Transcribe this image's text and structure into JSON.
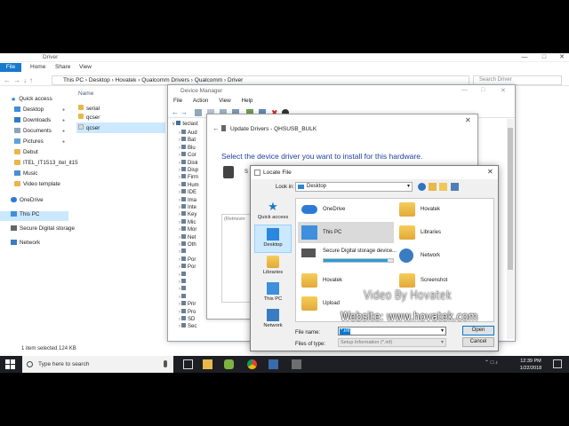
{
  "explorer": {
    "title": "Driver",
    "ribbon_file": "File",
    "ribbon_tabs": [
      "Home",
      "Share",
      "View"
    ],
    "breadcrumb": [
      "This PC",
      "Desktop",
      "Hovatek",
      "Qualcomm Drivers",
      "Qualcomm",
      "Driver"
    ],
    "search_placeholder": "Search Driver",
    "sidebar": [
      {
        "label": "Quick access",
        "icon": "star-icon"
      },
      {
        "label": "Desktop",
        "icon": "desktop-icon"
      },
      {
        "label": "Downloads",
        "icon": "download-icon"
      },
      {
        "label": "Documents",
        "icon": "documents-icon"
      },
      {
        "label": "Pictures",
        "icon": "pictures-icon"
      },
      {
        "label": "Debut",
        "icon": "folder-icon"
      },
      {
        "label": "ITEL_IT1513_itel_it15",
        "icon": "folder-icon"
      },
      {
        "label": "Music",
        "icon": "music-icon"
      },
      {
        "label": "Video template",
        "icon": "folder-icon"
      },
      {
        "label": "OneDrive",
        "icon": "cloud-icon"
      },
      {
        "label": "This PC",
        "icon": "pc-icon"
      },
      {
        "label": "Secure Digital storage",
        "icon": "drive-icon"
      },
      {
        "label": "Network",
        "icon": "network-icon"
      }
    ],
    "column_name": "Name",
    "files": [
      "serial",
      "qcser",
      "qcser"
    ],
    "status": "1 item selected  124 KB"
  },
  "device_manager": {
    "title": "Device Manager",
    "menu": [
      "File",
      "Action",
      "View",
      "Help"
    ],
    "tree_root": "teclast",
    "tree_items": [
      "Aud",
      "Bat",
      "Blu",
      "Cor",
      "Disk",
      "Disp",
      "Firm",
      "Hum",
      "IDE",
      "Ima",
      "Inte",
      "Key",
      "Mic",
      "Mor",
      "Net",
      "Oth",
      "",
      "Por",
      "Por",
      "",
      "",
      "",
      "",
      "Prir",
      "Pro",
      "SD",
      "Sec"
    ]
  },
  "update_drivers": {
    "title": "Update Drivers - QHSUSB_BULK",
    "heading": "Select the device driver you want to install for this hardware.",
    "subtext": "S",
    "box_text": "(Retrievin"
  },
  "locate_file": {
    "title": "Locate File",
    "look_in_label": "Look in:",
    "look_in_value": "Desktop",
    "places": [
      "Quick access",
      "Desktop",
      "Libraries",
      "This PC",
      "Network"
    ],
    "items": [
      {
        "label": "OneDrive",
        "icon": "cloud-icon"
      },
      {
        "label": "Hovatek",
        "icon": "user-folder-icon"
      },
      {
        "label": "This PC",
        "icon": "pc-icon"
      },
      {
        "label": "Libraries",
        "icon": "libraries-icon"
      },
      {
        "label": "Secure Digital storage device...",
        "icon": "drive-icon"
      },
      {
        "label": "Network",
        "icon": "network-icon"
      },
      {
        "label": "Hovatek",
        "icon": "folder-icon"
      },
      {
        "label": "Screenshot",
        "icon": "folder-icon"
      },
      {
        "label": "Upload",
        "icon": "folder-icon"
      }
    ],
    "storage_fill": 0.92,
    "file_name_label": "File name:",
    "file_name_value": "*.inf",
    "files_of_type_label": "Files of type:",
    "files_of_type_value": "Setup Information (*.inf)",
    "open_button": "Open",
    "cancel_button": "Cancel"
  },
  "watermark": {
    "line1": "Video By Hovatek",
    "line2": "Website: www.hovatek.com"
  },
  "taskbar": {
    "search_placeholder": "Type here to search",
    "time": "12:39 PM",
    "date": "1/22/2018"
  },
  "colors": {
    "accent": "#0078d7",
    "taskbar": "#1d1f24",
    "heading_blue": "#1f3f9e",
    "selection": "#cce8ff"
  }
}
